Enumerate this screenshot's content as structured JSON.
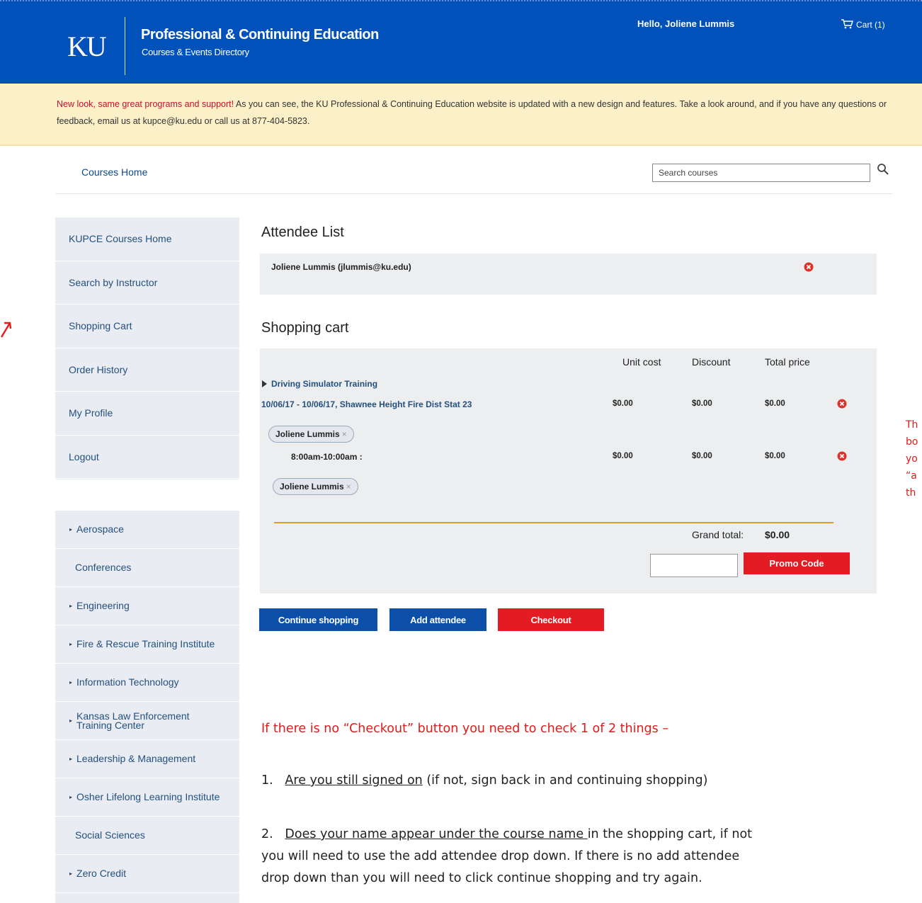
{
  "header": {
    "logo": "KU",
    "title": "Professional & Continuing Education",
    "subtitle": "Courses & Events Directory",
    "greeting": "Hello, Joliene  Lummis",
    "cart_label": "Cart (1)"
  },
  "banner": {
    "highlight": "New look, same great programs and support!",
    "text": " As you can see, the KU Professional & Continuing Education website is updated with a new design and features. Take a look around, and if you have any questions or feedback, email us at kupce@ku.edu or call us at 877-404-5823."
  },
  "subnav": {
    "home_label": "Courses Home",
    "search_placeholder": "Search courses"
  },
  "sidebar": {
    "items": [
      {
        "label": "KUPCE Courses Home"
      },
      {
        "label": "Search by Instructor"
      },
      {
        "label": "Shopping Cart"
      },
      {
        "label": "Order History"
      },
      {
        "label": "My Profile"
      },
      {
        "label": "Logout"
      }
    ],
    "categories": [
      {
        "label": "Aerospace",
        "arrow": "▸"
      },
      {
        "label": "Conferences",
        "arrow": ""
      },
      {
        "label": "Engineering",
        "arrow": "▸"
      },
      {
        "label": "Fire & Rescue Training Institute",
        "arrow": "▸"
      },
      {
        "label": "Information Technology",
        "arrow": "▸"
      },
      {
        "label": "Kansas Law Enforcement Training Center",
        "arrow": "▸"
      },
      {
        "label": "Leadership & Management",
        "arrow": "▸"
      },
      {
        "label": "Osher Lifelong Learning Institute",
        "arrow": "▸"
      },
      {
        "label": "Social Sciences",
        "arrow": ""
      },
      {
        "label": "Zero Credit",
        "arrow": "▸"
      }
    ]
  },
  "attendees": {
    "heading": "Attendee List",
    "name": "Joliene Lummis (jlummis@ku.edu)"
  },
  "cart": {
    "heading": "Shopping cart",
    "columns": {
      "unit": "Unit cost",
      "discount": "Discount",
      "total": "Total price"
    },
    "course_title": "Driving Simulator Training",
    "course_meta": "10/06/17 - 10/06/17, Shawnee Height Fire Dist Stat 23",
    "course_unit": "$0.00",
    "course_discount": "$0.00",
    "course_total": "$0.00",
    "attendee_pill": "Joliene Lummis",
    "session_time": "8:00am-10:00am :",
    "session_unit": "$0.00",
    "session_discount": "$0.00",
    "session_total": "$0.00",
    "session_pill": "Joliene Lummis",
    "pill_x": "×",
    "grand_label": "Grand total:",
    "grand_value": "$0.00",
    "promo_label": "Promo Code"
  },
  "buttons": {
    "continue": "Continue shopping",
    "add": "Add attendee",
    "checkout": "Checkout"
  },
  "notes": {
    "intro": "If there is no “Checkout” button you need to check 1 of 2 things –",
    "item1_num": "1.",
    "item1_underlined": "Are you still signed on",
    "item1_rest": " (if not, sign back in and continuing shopping)",
    "item2_num": "2.",
    "item2_underlined": "Does your name appear under the course name ",
    "item2_rest": "in the shopping cart, if not",
    "item2_line2": "you will need to use the add attendee drop down.  If there is no add attendee",
    "item2_line3": "drop down than you will need to click continue shopping and try again.",
    "side_lines": [
      "Th",
      "bo",
      "yo",
      "“a",
      "th"
    ]
  },
  "colors": {
    "header_blue": "#0051ba",
    "banner_yellow": "#fcf0c8",
    "button_blue": "#0b4fa8",
    "button_red": "#e31c23",
    "note_red": "#e01b1b"
  }
}
